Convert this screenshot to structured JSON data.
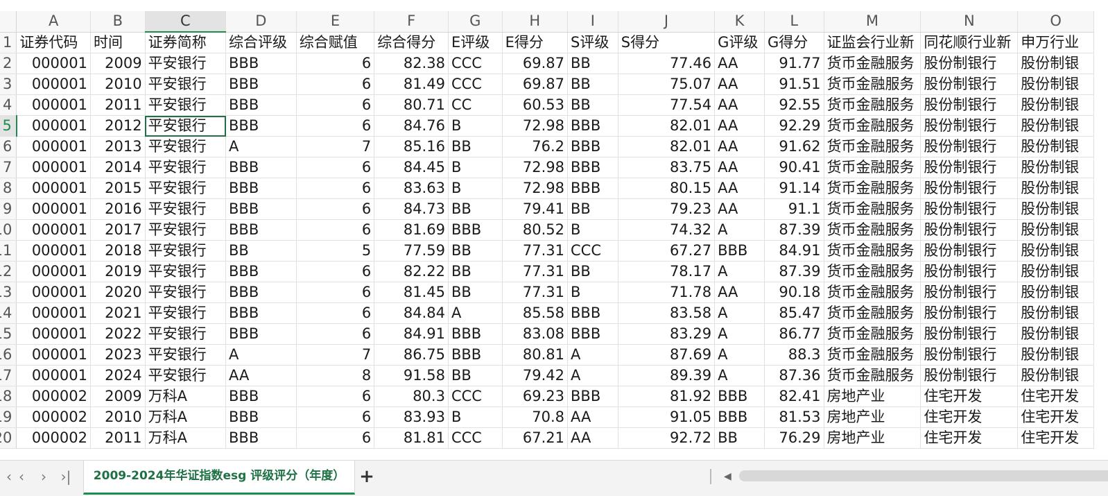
{
  "columns": [
    "A",
    "B",
    "C",
    "D",
    "E",
    "F",
    "G",
    "H",
    "I",
    "J",
    "K",
    "L",
    "M",
    "N",
    "O"
  ],
  "selected_column": "C",
  "selected_row": "5",
  "header_row": {
    "row_num": "1",
    "cells": [
      "证券代码",
      "时间",
      "证券简称",
      "综合评级",
      "综合赋值",
      "综合得分",
      "E评级",
      "E得分",
      "S评级",
      "S得分",
      "G评级",
      "G得分",
      "证监会行业新",
      "同花顺行业新",
      "申万行业"
    ]
  },
  "rows": [
    {
      "row_num": "2",
      "cells": [
        "000001",
        "2009",
        "平安银行",
        "BBB",
        "6",
        "82.38",
        "CCC",
        "69.87",
        "BB",
        "77.46",
        "AA",
        "91.77",
        "货币金融服务",
        "股份制银行",
        "股份制银"
      ]
    },
    {
      "row_num": "3",
      "cells": [
        "000001",
        "2010",
        "平安银行",
        "BBB",
        "6",
        "81.49",
        "CCC",
        "69.87",
        "BB",
        "75.07",
        "AA",
        "91.51",
        "货币金融服务",
        "股份制银行",
        "股份制银"
      ]
    },
    {
      "row_num": "4",
      "cells": [
        "000001",
        "2011",
        "平安银行",
        "BBB",
        "6",
        "80.71",
        "CC",
        "60.53",
        "BB",
        "77.54",
        "AA",
        "92.55",
        "货币金融服务",
        "股份制银行",
        "股份制银"
      ]
    },
    {
      "row_num": "5",
      "cells": [
        "000001",
        "2012",
        "平安银行",
        "BBB",
        "6",
        "84.76",
        "B",
        "72.98",
        "BBB",
        "82.01",
        "AA",
        "92.29",
        "货币金融服务",
        "股份制银行",
        "股份制银"
      ]
    },
    {
      "row_num": "6",
      "cells": [
        "000001",
        "2013",
        "平安银行",
        "A",
        "7",
        "85.16",
        "BB",
        "76.2",
        "BBB",
        "82.01",
        "AA",
        "91.62",
        "货币金融服务",
        "股份制银行",
        "股份制银"
      ]
    },
    {
      "row_num": "7",
      "cells": [
        "000001",
        "2014",
        "平安银行",
        "BBB",
        "6",
        "84.45",
        "B",
        "72.98",
        "BBB",
        "83.75",
        "AA",
        "90.41",
        "货币金融服务",
        "股份制银行",
        "股份制银"
      ]
    },
    {
      "row_num": "8",
      "cells": [
        "000001",
        "2015",
        "平安银行",
        "BBB",
        "6",
        "83.63",
        "B",
        "72.98",
        "BBB",
        "80.15",
        "AA",
        "91.14",
        "货币金融服务",
        "股份制银行",
        "股份制银"
      ]
    },
    {
      "row_num": "9",
      "cells": [
        "000001",
        "2016",
        "平安银行",
        "BBB",
        "6",
        "84.73",
        "BB",
        "79.41",
        "BB",
        "79.23",
        "AA",
        "91.1",
        "货币金融服务",
        "股份制银行",
        "股份制银"
      ]
    },
    {
      "row_num": "10",
      "cells": [
        "000001",
        "2017",
        "平安银行",
        "BBB",
        "6",
        "81.69",
        "BBB",
        "80.52",
        "B",
        "74.32",
        "A",
        "87.39",
        "货币金融服务",
        "股份制银行",
        "股份制银"
      ]
    },
    {
      "row_num": "11",
      "cells": [
        "000001",
        "2018",
        "平安银行",
        "BB",
        "5",
        "77.59",
        "BB",
        "77.31",
        "CCC",
        "67.27",
        "BBB",
        "84.91",
        "货币金融服务",
        "股份制银行",
        "股份制银"
      ]
    },
    {
      "row_num": "12",
      "cells": [
        "000001",
        "2019",
        "平安银行",
        "BBB",
        "6",
        "82.22",
        "BB",
        "77.31",
        "BB",
        "78.17",
        "A",
        "87.39",
        "货币金融服务",
        "股份制银行",
        "股份制银"
      ]
    },
    {
      "row_num": "13",
      "cells": [
        "000001",
        "2020",
        "平安银行",
        "BBB",
        "6",
        "81.45",
        "BB",
        "77.31",
        "B",
        "71.78",
        "AA",
        "90.18",
        "货币金融服务",
        "股份制银行",
        "股份制银"
      ]
    },
    {
      "row_num": "14",
      "cells": [
        "000001",
        "2021",
        "平安银行",
        "BBB",
        "6",
        "84.84",
        "A",
        "85.58",
        "BBB",
        "83.58",
        "A",
        "85.47",
        "货币金融服务",
        "股份制银行",
        "股份制银"
      ]
    },
    {
      "row_num": "15",
      "cells": [
        "000001",
        "2022",
        "平安银行",
        "BBB",
        "6",
        "84.91",
        "BBB",
        "83.08",
        "BBB",
        "83.29",
        "A",
        "86.77",
        "货币金融服务",
        "股份制银行",
        "股份制银"
      ]
    },
    {
      "row_num": "16",
      "cells": [
        "000001",
        "2023",
        "平安银行",
        "A",
        "7",
        "86.75",
        "BBB",
        "80.81",
        "A",
        "87.69",
        "A",
        "88.3",
        "货币金融服务",
        "股份制银行",
        "股份制银"
      ]
    },
    {
      "row_num": "17",
      "cells": [
        "000001",
        "2024",
        "平安银行",
        "AA",
        "8",
        "91.58",
        "BB",
        "79.42",
        "A",
        "89.39",
        "A",
        "87.36",
        "货币金融服务",
        "股份制银行",
        "股份制银"
      ]
    },
    {
      "row_num": "18",
      "cells": [
        "000002",
        "2009",
        "万科A",
        "BBB",
        "6",
        "80.3",
        "CCC",
        "69.23",
        "BBB",
        "81.92",
        "BBB",
        "82.41",
        "房地产业",
        "住宅开发",
        "住宅开发"
      ]
    },
    {
      "row_num": "19",
      "cells": [
        "000002",
        "2010",
        "万科A",
        "BBB",
        "6",
        "83.93",
        "B",
        "70.8",
        "AA",
        "91.05",
        "BBB",
        "81.53",
        "房地产业",
        "住宅开发",
        "住宅开发"
      ]
    },
    {
      "row_num": "20",
      "cells": [
        "000002",
        "2011",
        "万科A",
        "BBB",
        "6",
        "81.81",
        "CCC",
        "67.21",
        "AA",
        "92.72",
        "BB",
        "76.29",
        "房地产业",
        "住宅开发",
        "住宅开发"
      ]
    }
  ],
  "sheet_tab": {
    "label": "2009-2024年华证指数esg 评级评分（年度）"
  },
  "nav": {
    "first": "|<",
    "prev": "<",
    "next": ">",
    "last": ">|"
  },
  "add_sheet_label": "+",
  "accent_color": "#1e7145"
}
